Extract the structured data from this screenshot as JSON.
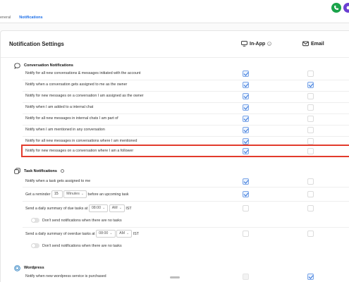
{
  "header": {
    "tabs": [
      {
        "label": "eneral"
      },
      {
        "label": "Notifications"
      }
    ],
    "icons": [
      "phone-icon",
      "avatar-icon"
    ]
  },
  "card": {
    "title": "Notification Settings",
    "columns": {
      "in_app": "In-App",
      "email": "Email"
    }
  },
  "sections": {
    "conversation": {
      "title": "Conversation Notifications",
      "rows": [
        {
          "label": "Notify for all new conversations & messages initiated with the account",
          "in_app": true,
          "email": false
        },
        {
          "label": "Notify when a conversation gets assigned to me as the owner",
          "in_app": true,
          "email": true
        },
        {
          "label": "Notify for new messages on a conversation I am assigned as the owner",
          "in_app": true,
          "email": false
        },
        {
          "label": "Notify when I am added to a internal chat",
          "in_app": true,
          "email": false
        },
        {
          "label": "Notify for all new messages in internal chats I am part of",
          "in_app": true,
          "email": false
        },
        {
          "label": "Notify when I am mentioned in any conversation",
          "in_app": true,
          "email": false
        },
        {
          "label": "Notify for all new messages in conversations where I am mentioned",
          "in_app": true,
          "email": false
        },
        {
          "label": "Notify for new messages on a conversation where I am a follower",
          "in_app": true,
          "email": false
        }
      ]
    },
    "task": {
      "title": "Task Notifications",
      "row_assigned": "Notify when a task gets assigned to me",
      "reminder": {
        "prefix": "Get a reminder",
        "amount": "15",
        "unit": "Minutes",
        "suffix": "before an upcoming task"
      },
      "due": {
        "prefix": "Send a daily summary of due tasks at",
        "time": "08:00",
        "ampm": "AM",
        "tz": "IST"
      },
      "due_toggle": "Don't send notifications when there are no tasks",
      "overdue": {
        "prefix": "Send a daily summary of overdue tasks at",
        "time": "08:00",
        "ampm": "AM",
        "tz": "IST"
      },
      "overdue_toggle": "Don't send notifications when there are no tasks"
    },
    "wordpress": {
      "title": "Wordpress",
      "rows": [
        {
          "label": "Notify when new wordpress service is purchased",
          "in_app": false,
          "email": true
        }
      ]
    }
  },
  "colors": {
    "accent": "#1d6fe8",
    "highlight": "#e23b2c",
    "green": "#1aa34a",
    "purple": "#6a3fd1"
  }
}
